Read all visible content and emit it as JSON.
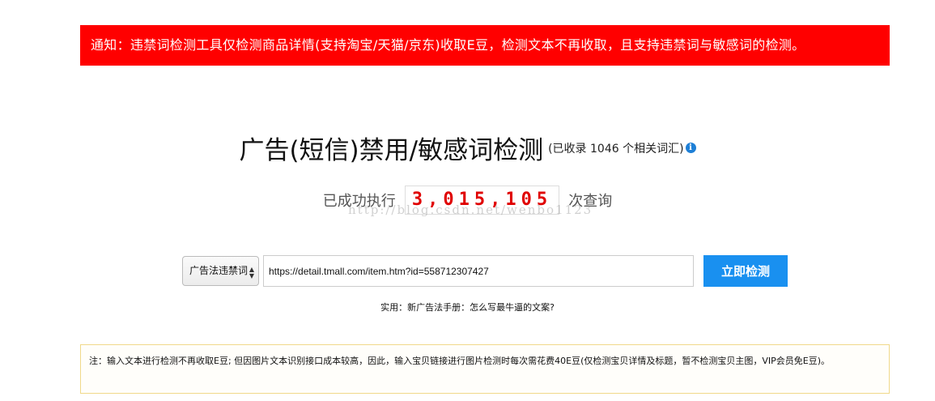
{
  "notice": {
    "text": "通知：违禁词检测工具仅检测商品详情(支持淘宝/天猫/京东)收取E豆，检测文本不再收取，且支持违禁词与敏感词的检测。"
  },
  "title": {
    "main": "广告(短信)禁用/敏感词检测",
    "sub": "(已收录 1046 个相关词汇)",
    "info_icon": "info-icon"
  },
  "counter": {
    "prefix": "已成功执行",
    "value": "3,015,105",
    "suffix": "次查询"
  },
  "watermark": {
    "text": "http://blog.csdn.net/wenbo1123"
  },
  "search": {
    "select_value": "广告法违禁词",
    "url_value": "https://detail.tmall.com/item.htm?id=558712307427",
    "button_label": "立即检测"
  },
  "helper": {
    "prefix": "实用：",
    "link_text": "新广告法手册：怎么写最牛逼的文案?"
  },
  "note": {
    "text": "注：输入文本进行检测不再收取E豆; 但因图片文本识别接口成本较高，因此，输入宝贝链接进行图片检测时每次需花费40E豆(仅检测宝贝详情及标题，暂不检测宝贝主图，VIP会员免E豆)。"
  },
  "colors": {
    "notice_bg": "#ff0000",
    "counter_digits": "#e00000",
    "button_bg": "#1990f0",
    "info_icon": "#1e7fd6",
    "note_border": "#f0d98a"
  }
}
